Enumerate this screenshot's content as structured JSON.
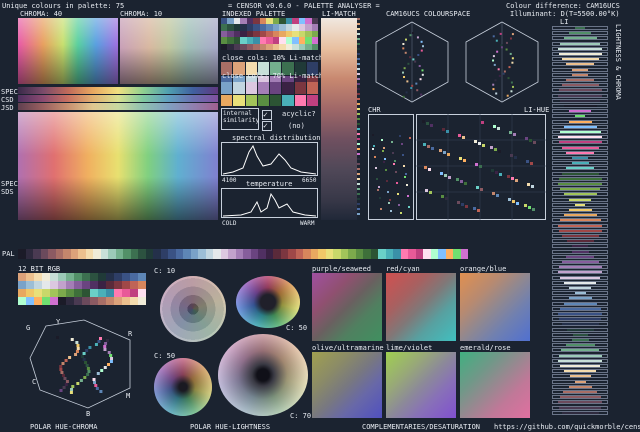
{
  "header": {
    "unique_colours": "Unique colours in palette: 75",
    "title": "= CENSOR v0.6.0 - PALETTE ANALYSER =",
    "colour_difference": "Colour difference: CAM16UCS",
    "illuminant": "Illuminant: D(T=5500.00°K)"
  },
  "sections": {
    "chroma_40": "CHROMA: 40",
    "chroma_10": "CHROMA: 10",
    "indexed_palette": "INDEXED PALETTE",
    "li_match": "LI-MATCH",
    "cam16_space": "CAM16UCS COLOURSPACE",
    "close_cols_10": "close cols: 10% Li-match",
    "close_cols_70": "close cols: 70% Li-match",
    "internal_similarity": "internal similarity",
    "cyclic": "acyclic?",
    "cyclic_value": "(no)",
    "spectral": "spectral distribution",
    "spectral_min": "4100",
    "spectral_max": "6650",
    "temperature": "temperature",
    "cold": "COLD",
    "warm": "WARM",
    "chr": "CHR",
    "li_hue": "LI-HUE",
    "li": "LI",
    "lightness_chroma": "LIGHTNESS & CHROMA",
    "pal": "PAL",
    "spec": "SPEC",
    "csd": "CSD",
    "jsd": "JSD",
    "spec2": "SPEC",
    "sds": "SDS",
    "rgb12": "12 BIT RGB",
    "c10a": "C: 10",
    "c50a": "C: 50",
    "c50b": "C: 50",
    "c70": "C: 70",
    "purple_seaweed": "purple/seaweed",
    "red_cyan": "red/cyan",
    "orange_blue": "orange/blue",
    "olive_ultramarine": "olive/ultramarine",
    "lime_violet": "lime/violet",
    "emerald_rose": "emerald/rose",
    "polar_hue_chroma": "POLAR HUE-CHROMA",
    "polar_hue_lightness": "POLAR HUE-LIGHTNESS",
    "complementaries": "COMPLEMENTARIES/DESATURATION",
    "url": "https://github.com/quickmorble/censor",
    "hue_g": "G",
    "hue_y": "Y",
    "hue_r": "R",
    "hue_c": "C",
    "hue_b": "B",
    "hue_m": "M"
  },
  "palette": [
    "#1b1b28",
    "#2e2a3e",
    "#4a3a52",
    "#6b4a5c",
    "#8c5a62",
    "#a86e66",
    "#c4866c",
    "#dca27a",
    "#ecc08e",
    "#f4dcae",
    "#f0ecd8",
    "#c8e0d8",
    "#9ccab8",
    "#74b08e",
    "#529068",
    "#3c7050",
    "#2c5240",
    "#203a38",
    "#24304a",
    "#2e3e66",
    "#3a5284",
    "#4a6aa0",
    "#5e86b6",
    "#7aa2c8",
    "#9cbed6",
    "#c2d6e0",
    "#e4e8ea",
    "#dcc8e0",
    "#c2a2cc",
    "#a47eb6",
    "#865e9c",
    "#6a4480",
    "#503062",
    "#3a2244",
    "#5a2a3a",
    "#7c3640",
    "#a04848",
    "#c06456",
    "#d8865c",
    "#e8a860",
    "#f0c868",
    "#e8e07a",
    "#c8d86a",
    "#a2c45a",
    "#7caa4c",
    "#5a8e42",
    "#3e703a",
    "#2c5434",
    "#6ad0c8",
    "#4ab0b8",
    "#3a90a8",
    "#ff7ab0",
    "#e85a98",
    "#c04080",
    "#ffe0f0",
    "#b0ffd0",
    "#80c0ff",
    "#ffb060",
    "#70e070",
    "#d070d0"
  ]
}
